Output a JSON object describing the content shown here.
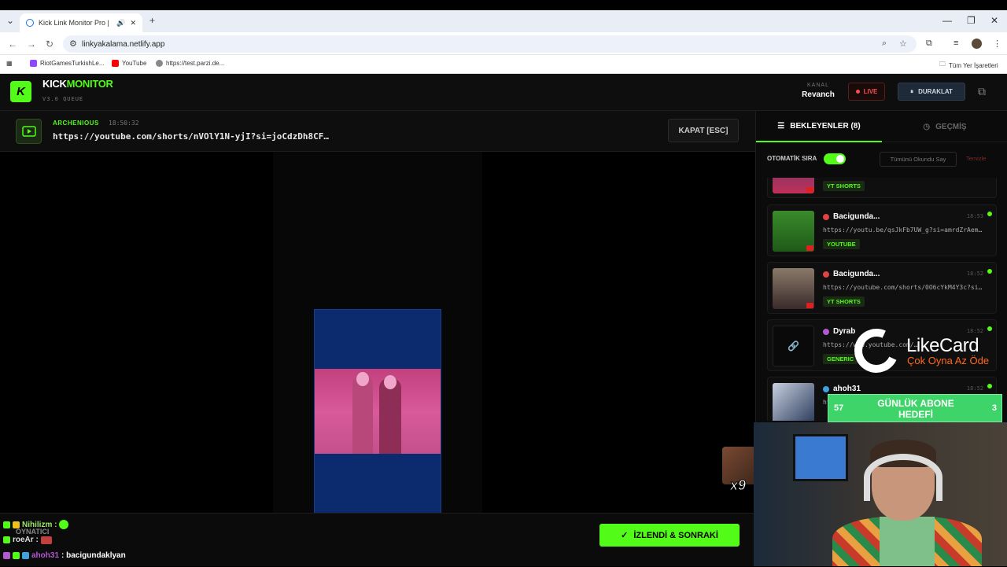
{
  "browser": {
    "tab_title": "Kick Link Monitor Pro | Stre",
    "url": "linkyakalama.netlify.app",
    "bookmarks": [
      "RiotGamesTurkishLe...",
      "YouTube",
      "https://test.parzi.de..."
    ],
    "all_bookmarks": "Tüm Yer İşaretleri"
  },
  "app": {
    "brand_a": "KICK",
    "brand_b": "MONITOR",
    "version": "V3.0 QUEUE",
    "kanal_label": "KANAL",
    "kanal_value": "Revanch",
    "live_label": "LIVE",
    "pause_label": "DURAKLAT"
  },
  "current": {
    "user": "ARCHENIOUS",
    "time": "18:50:32",
    "url": "https://youtube.com/shorts/nVOlY1N-yjI?si=joCdzDh8CF…",
    "close_label": "KAPAT [ESC]"
  },
  "overlay": {
    "emote_count": "x9",
    "likecard_title": "LikeCard",
    "likecard_slogan": "Çok Oyna  Az Öde",
    "goal_left": "57",
    "goal_title": "GÜNLÜK ABONE HEDEFİ",
    "goal_right": "3"
  },
  "chat": [
    {
      "user": "Nihilizm :",
      "color": "#9be86a",
      "msg": ""
    },
    {
      "user": "roeAr :",
      "color": "#dddddd",
      "msg": ""
    },
    {
      "user": "ahoh31",
      "color": "#b05ad0",
      "msg": ": bacigundaklyan"
    }
  ],
  "chat_overlay_text": "OYNATICI",
  "watched_label": "İZLENDİ & SONRAKİ",
  "sidebar": {
    "tab_waiting": "BEKLEYENLER (8)",
    "tab_history": "GEÇMİŞ",
    "auto_label": "OTOMATİK SIRA",
    "mark_all": "Tümünü Okundu Say",
    "clear": "Temizle",
    "items": [
      {
        "name": "",
        "time": "",
        "url": "",
        "tag": "YT SHORTS"
      },
      {
        "name": "Bacigunda...",
        "time": "18:53",
        "url": "https://youtu.be/qsJkFb7UW_g?si=amrdZrAem…",
        "tag": "YOUTUBE"
      },
      {
        "name": "Bacigunda...",
        "time": "18:52",
        "url": "https://youtube.com/shorts/0O6cYkM4Y3c?si…",
        "tag": "YT SHORTS"
      },
      {
        "name": "Dyrab",
        "time": "18:52",
        "url": "https://www.youtube.com/…",
        "tag": "GENERIC"
      },
      {
        "name": "ahoh31",
        "time": "18:52",
        "url": "ht",
        "tag": ""
      }
    ]
  },
  "colors": {
    "accent": "#53fc18",
    "live": "#ff4d4d"
  }
}
